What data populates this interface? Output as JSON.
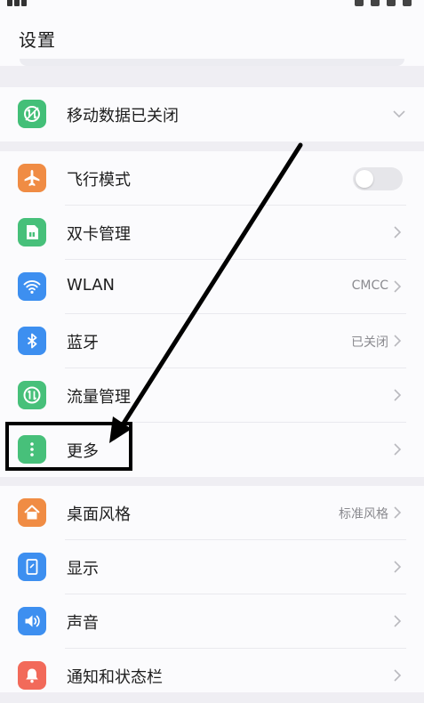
{
  "header": {
    "title": "设置"
  },
  "sections": [
    {
      "items": [
        {
          "label": "移动数据已关闭",
          "icon": "mobile-data-icon",
          "accent": "#43bf78",
          "control": "expand",
          "value": ""
        }
      ]
    },
    {
      "items": [
        {
          "label": "飞行模式",
          "icon": "airplane-icon",
          "accent": "#f08c44",
          "control": "toggle",
          "toggle_on": false,
          "value": ""
        },
        {
          "label": "双卡管理",
          "icon": "sim-card-icon",
          "accent": "#47c07a",
          "control": "chevron",
          "value": ""
        },
        {
          "label": "WLAN",
          "icon": "wifi-icon",
          "accent": "#3d8ff0",
          "control": "chevron",
          "value": "CMCC"
        },
        {
          "label": "蓝牙",
          "icon": "bluetooth-icon",
          "accent": "#3d8ff0",
          "control": "chevron",
          "value": "已关闭"
        },
        {
          "label": "流量管理",
          "icon": "data-usage-icon",
          "accent": "#47c07a",
          "control": "chevron",
          "value": ""
        },
        {
          "label": "更多",
          "icon": "more-icon",
          "accent": "#47c07a",
          "control": "chevron",
          "value": ""
        }
      ]
    },
    {
      "items": [
        {
          "label": "桌面风格",
          "icon": "home-screen-icon",
          "accent": "#f08c44",
          "control": "chevron",
          "value": "标准风格"
        },
        {
          "label": "显示",
          "icon": "display-icon",
          "accent": "#3d8ff0",
          "control": "chevron",
          "value": ""
        },
        {
          "label": "声音",
          "icon": "sound-icon",
          "accent": "#3d8ff0",
          "control": "chevron",
          "value": ""
        },
        {
          "label": "通知和状态栏",
          "icon": "notification-icon",
          "accent": "#f26a5a",
          "control": "chevron",
          "value": ""
        }
      ]
    }
  ],
  "annotation": {
    "highlighted_item": "更多",
    "color": "#000000"
  }
}
